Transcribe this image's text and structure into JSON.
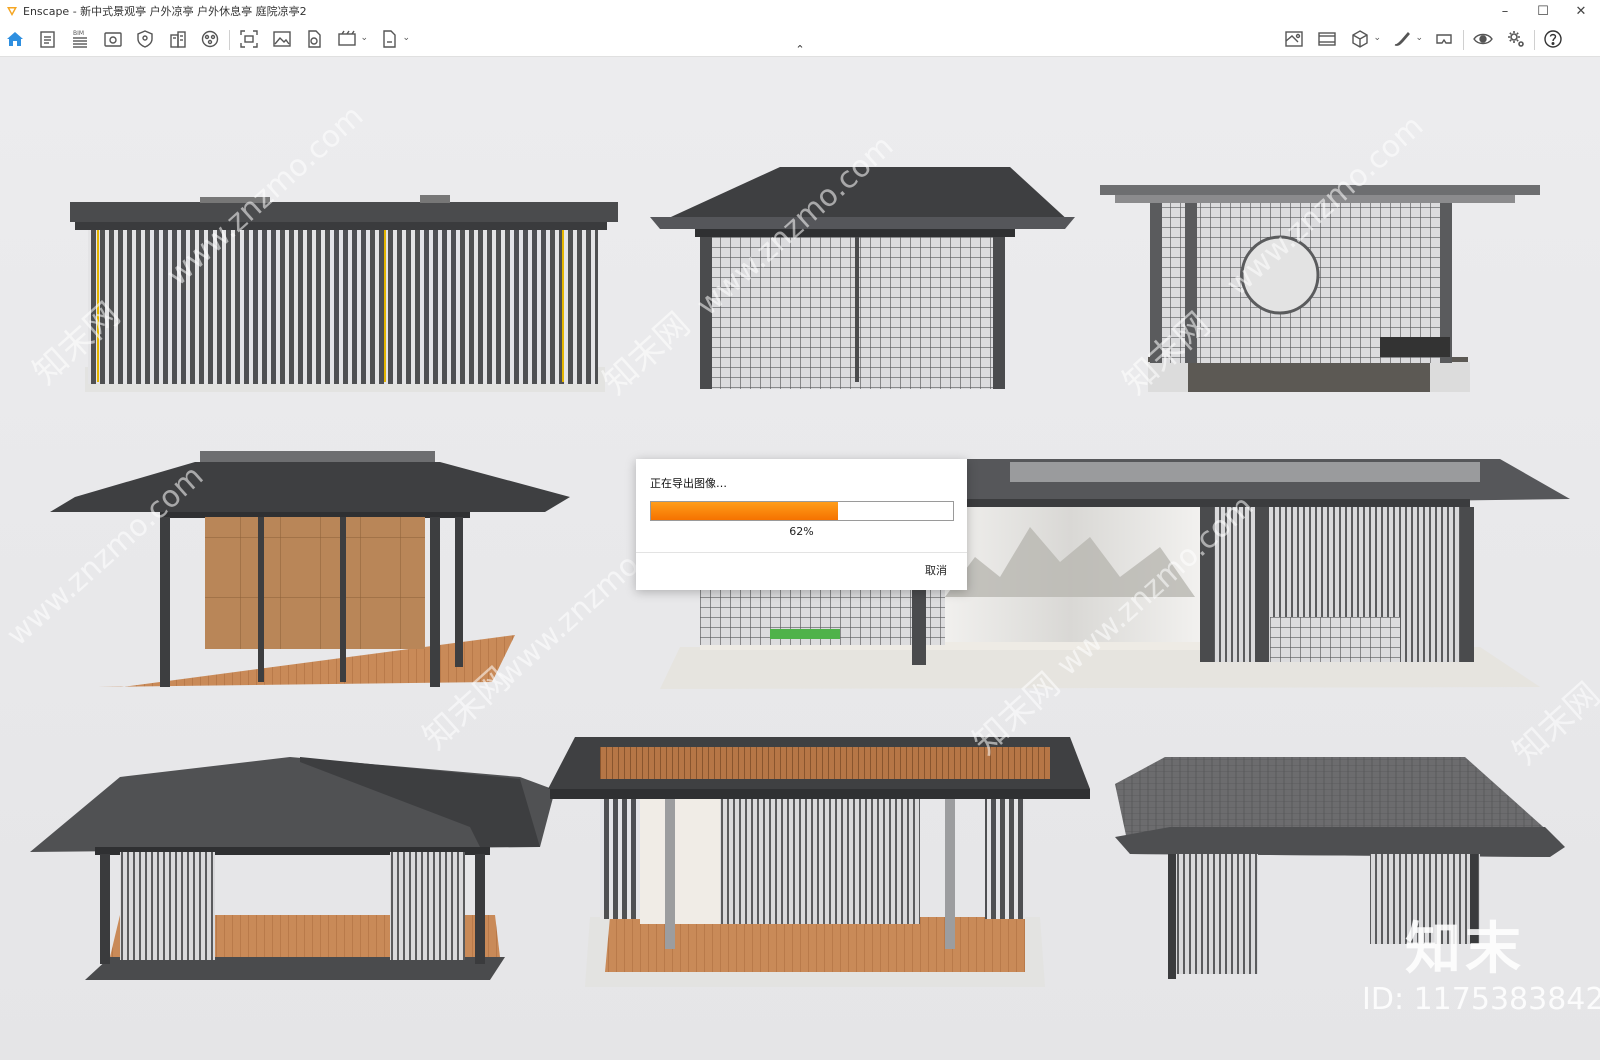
{
  "window": {
    "title": "Enscape - 新中式景观亭 户外凉亭 户外休息亭 庭院凉亭2",
    "controls": [
      "–",
      "☐",
      "✕"
    ]
  },
  "toolbar": {
    "left_icons": [
      "home-icon",
      "document-icon",
      "bim-icon",
      "view-icon",
      "shield-icon",
      "building-icon",
      "material-icon",
      "screenshot-icon",
      "image-icon",
      "export-icon",
      "batch-render-icon",
      "export-file-icon"
    ],
    "right_icons": [
      "asset-library-icon",
      "video-icon",
      "cube-icon",
      "settings-brush-icon",
      "vr-icon",
      "eye-icon",
      "gear-icon",
      "help-icon"
    ],
    "bim_label": "BIM"
  },
  "dialog": {
    "title": "正在导出图像…",
    "progress": 0.62,
    "progress_label": "62%",
    "cancel_label": "取消"
  },
  "watermarks": {
    "site": "www.znzmo.com",
    "brand": "知末网",
    "logo_text": "知末",
    "id_text": "ID: 1175383842"
  },
  "colors": {
    "accent": "#f57200",
    "roof": "#4a4a4c",
    "metal": "#58595b",
    "wood": "#c8895a",
    "background": "#e9e9ea"
  }
}
